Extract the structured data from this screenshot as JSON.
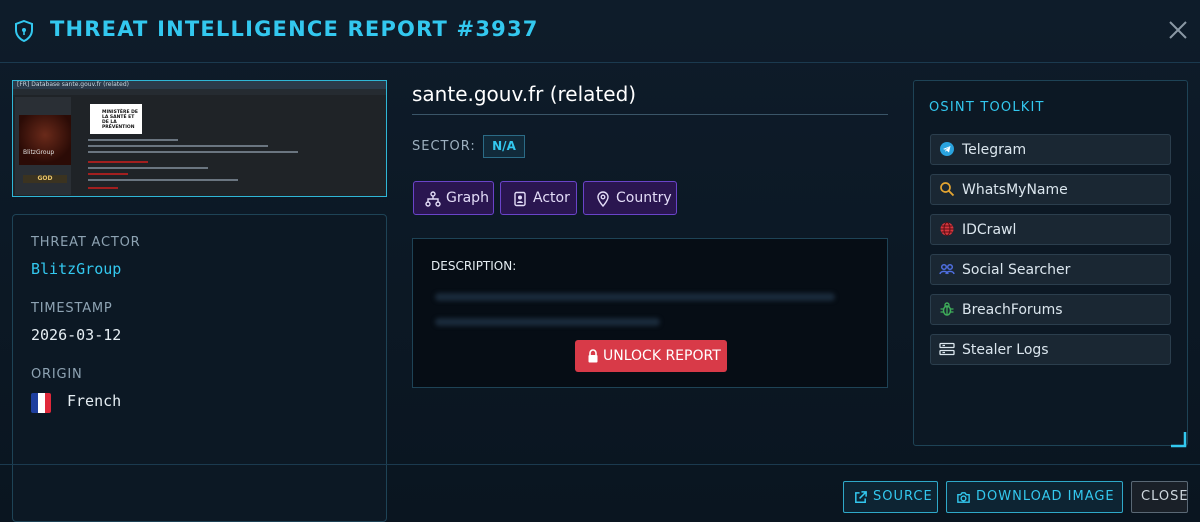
{
  "header": {
    "title": "THREAT INTELLIGENCE REPORT #3937",
    "close_icon": "close-icon",
    "shield_icon": "shield-icon"
  },
  "preview": {
    "thread_title": "[FR] Database sante.gouv.fr (related)",
    "username": "BlitzGroup",
    "badge": "GOD",
    "logo_text": "MINISTÈRE DE LA SANTÉ ET DE LA PRÉVENTION"
  },
  "details": {
    "threat_actor_label": "THREAT ACTOR",
    "threat_actor": "BlitzGroup",
    "timestamp_label": "TIMESTAMP",
    "timestamp": "2026-03-12",
    "origin_label": "ORIGIN",
    "origin": "French"
  },
  "main": {
    "domain": "sante.gouv.fr (related)",
    "sector_label": "SECTOR:",
    "sector_value": "N/A",
    "pills": [
      {
        "label": "Graph",
        "icon": "graph-icon"
      },
      {
        "label": "Actor",
        "icon": "id-card-icon"
      },
      {
        "label": "Country",
        "icon": "map-pin-icon"
      }
    ],
    "description_label": "DESCRIPTION:",
    "unlock_label": "UNLOCK REPORT"
  },
  "osint": {
    "title": "OSINT TOOLKIT",
    "tools": [
      {
        "label": "Telegram",
        "icon": "telegram-icon"
      },
      {
        "label": "WhatsMyName",
        "icon": "search-icon"
      },
      {
        "label": "IDCrawl",
        "icon": "globe-icon"
      },
      {
        "label": "Social Searcher",
        "icon": "users-icon"
      },
      {
        "label": "BreachForums",
        "icon": "bug-icon"
      },
      {
        "label": "Stealer Logs",
        "icon": "terminal-icon"
      }
    ]
  },
  "footer": {
    "source_label": "SOURCE",
    "download_label": "DOWNLOAD IMAGE",
    "close_label": "CLOSE"
  },
  "colors": {
    "accent": "#33c8ef",
    "purple": "#6a44c9",
    "danger": "#d83a48"
  }
}
